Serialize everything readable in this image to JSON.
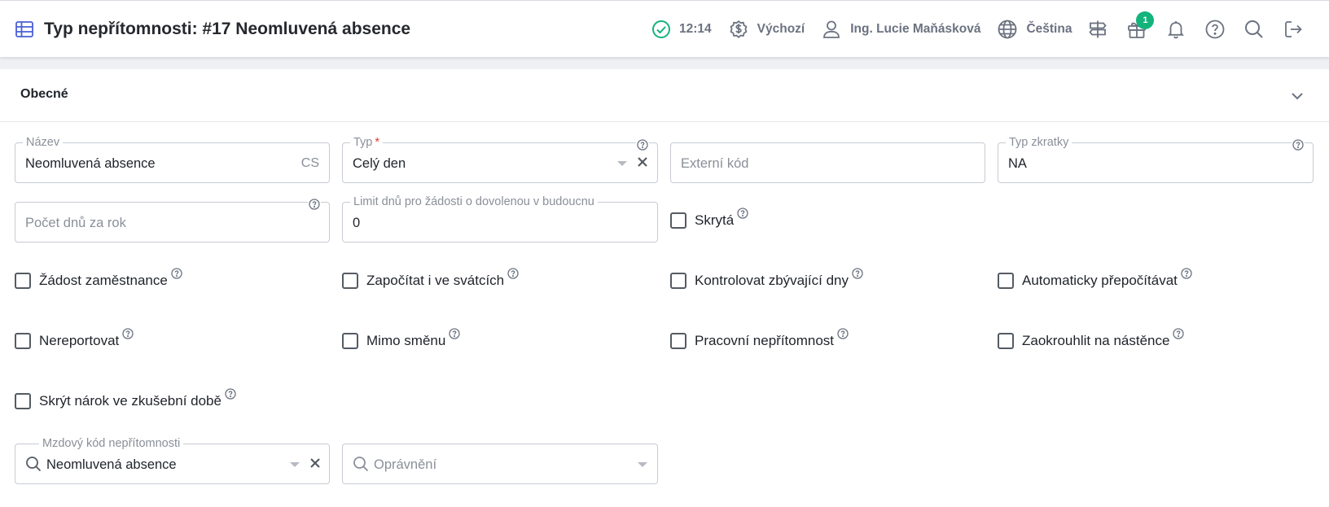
{
  "header": {
    "title": "Typ nepřítomnosti: #17 Neomluvená absence",
    "time": "12:14",
    "currency_label": "Výchozí",
    "user_name": "Ing. Lucie Maňásková",
    "language": "Čeština",
    "gift_badge": "1",
    "status_color": "#14b37c",
    "icons": [
      "table-icon",
      "check-circle-icon",
      "currency-icon",
      "user-icon",
      "globe-icon",
      "signpost-icon",
      "gift-icon",
      "bell-icon",
      "help-icon",
      "search-icon",
      "logout-icon"
    ]
  },
  "section": {
    "title": "Obecné"
  },
  "form": {
    "nazev": {
      "label": "Název",
      "value": "Neomluvená absence",
      "lang": "CS"
    },
    "typ": {
      "label": "Typ",
      "required_mark": "*",
      "value": "Celý den"
    },
    "externi_kod": {
      "placeholder": "Externí kód"
    },
    "typ_zkratky": {
      "label": "Typ zkratky",
      "value": "NA"
    },
    "pocet_dnu": {
      "placeholder": "Počet dnů za rok"
    },
    "limit_dnu": {
      "label": "Limit dnů pro žádosti o dovolenou v budoucnu",
      "value": "0"
    },
    "skryta": {
      "label": "Skrytá",
      "checked": false
    },
    "checkboxes": [
      {
        "label": "Žádost zaměstnance",
        "checked": false
      },
      {
        "label": "Započítat i ve svátcích",
        "checked": false
      },
      {
        "label": "Kontrolovat zbývající dny",
        "checked": false
      },
      {
        "label": "Automaticky přepočítávat",
        "checked": false
      },
      {
        "label": "Nereportovat",
        "checked": false
      },
      {
        "label": "Mimo směnu",
        "checked": false
      },
      {
        "label": "Pracovní nepřítomnost",
        "checked": false
      },
      {
        "label": "Zaokrouhlit na nástěnce",
        "checked": false
      },
      {
        "label": "Skrýt nárok ve zkušební době",
        "checked": false
      }
    ],
    "mzdovy_kod": {
      "label": "Mzdový kód nepřítomnosti",
      "value": "Neomluvená absence"
    },
    "opravneni": {
      "placeholder": "Oprávnění"
    }
  }
}
